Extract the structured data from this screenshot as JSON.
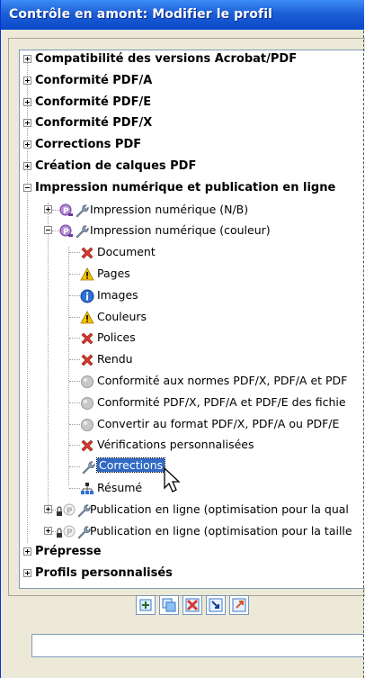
{
  "window": {
    "title": "Contrôle en amont: Modifier le profil"
  },
  "tree": {
    "top_items": [
      "Compatibilité des versions Acrobat/PDF",
      "Conformité PDF/A",
      "Conformité PDF/E",
      "Conformité PDF/X",
      "Corrections PDF",
      "Création de calques PDF"
    ],
    "expanded_item": "Impression numérique et publication en ligne",
    "profile_bw": "Impression numérique (N/B)",
    "profile_color": "Impression numérique (couleur)",
    "children": [
      {
        "label": "Document",
        "status": "error"
      },
      {
        "label": "Pages",
        "status": "warning"
      },
      {
        "label": "Images",
        "status": "info"
      },
      {
        "label": "Couleurs",
        "status": "warning"
      },
      {
        "label": "Polices",
        "status": "error"
      },
      {
        "label": "Rendu",
        "status": "error"
      },
      {
        "label": "Conformité aux normes PDF/X, PDF/A et PDF",
        "status": "disabled"
      },
      {
        "label": "Conformité PDF/X, PDF/A et PDF/E des fichie",
        "status": "disabled"
      },
      {
        "label": "Convertir au format PDF/X, PDF/A ou PDF/E",
        "status": "disabled"
      },
      {
        "label": "Vérifications personnalisées",
        "status": "error"
      },
      {
        "label": "Corrections",
        "status": "wrench",
        "selected": true
      },
      {
        "label": "Résumé",
        "status": "summary"
      }
    ],
    "publication_items": [
      "Publication en ligne (optimisation pour la qual",
      "Publication en ligne (optimisation pour la taille"
    ],
    "bottom_items": [
      "Prépresse",
      "Profils personnalisés"
    ]
  },
  "toolbar": {
    "buttons": [
      "new-profile-icon",
      "duplicate-profile-icon",
      "delete-profile-icon",
      "import-profile-icon",
      "export-profile-icon"
    ]
  },
  "status_field": {
    "value": ""
  },
  "colors": {
    "titlebar": "#1d5fd6",
    "selection": "#316ac5",
    "error": "#d63a2f",
    "warning": "#f2c200",
    "info": "#2f6fd8"
  }
}
